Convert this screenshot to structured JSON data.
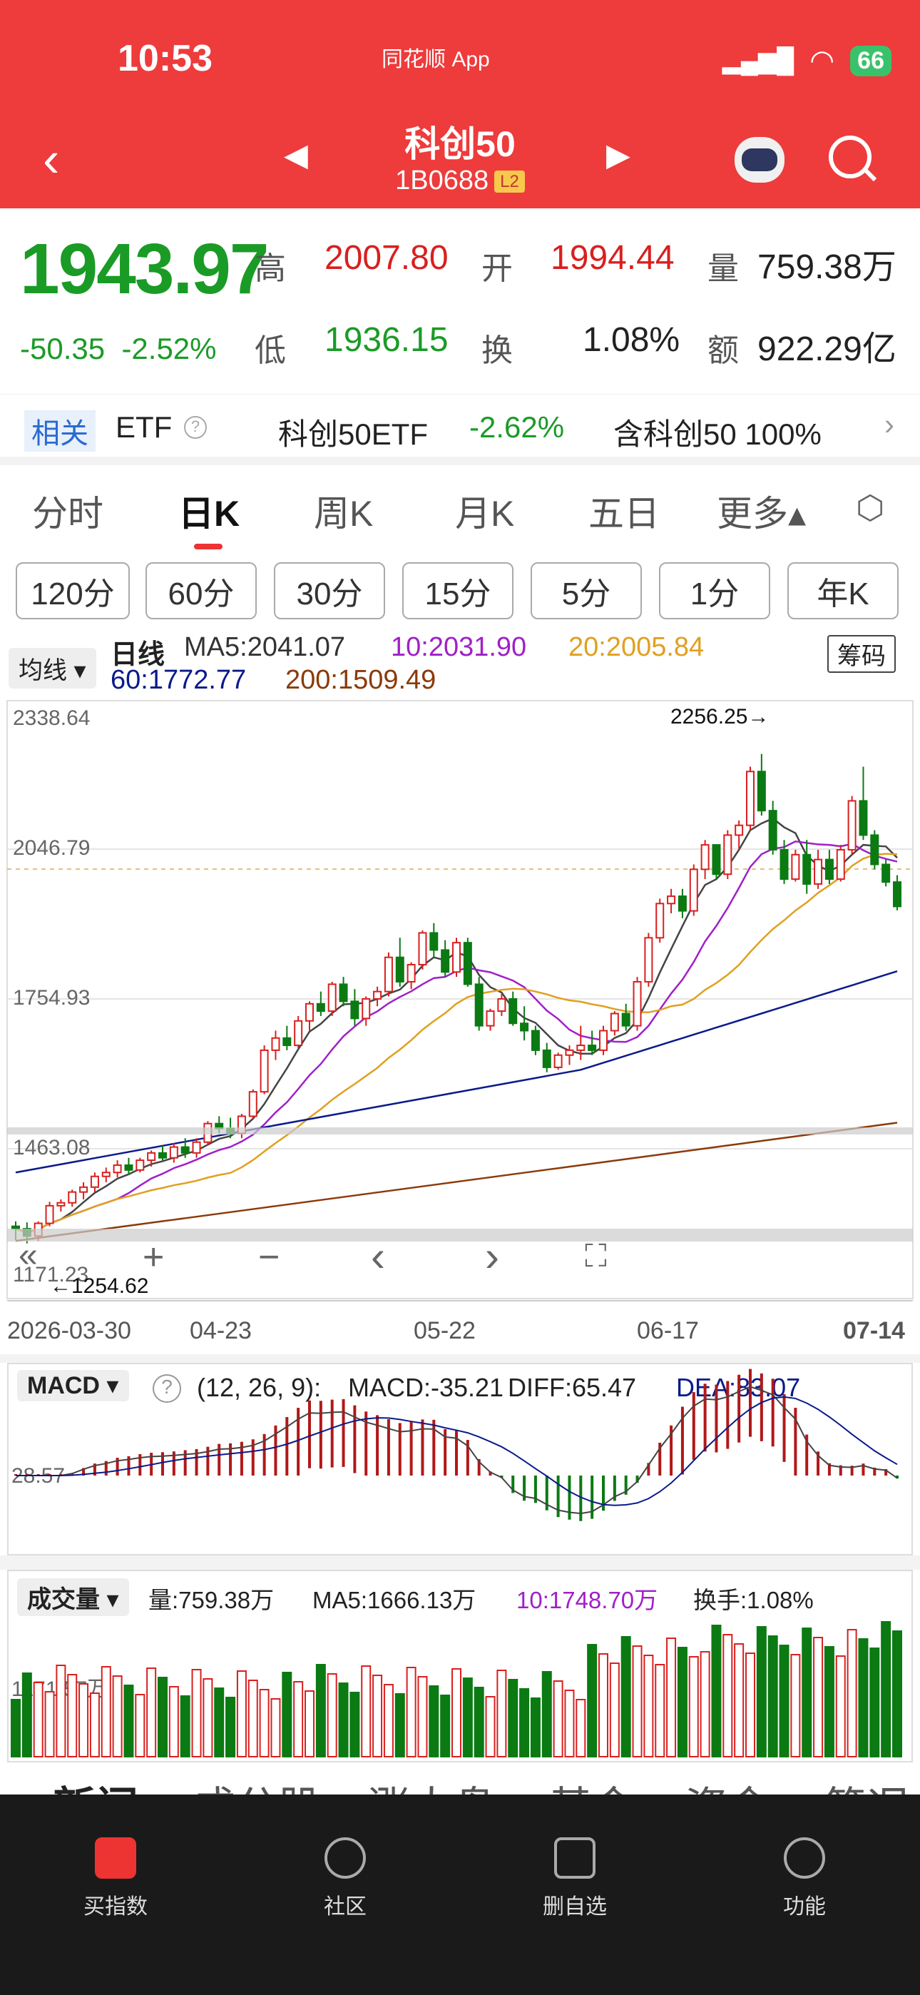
{
  "status": {
    "time": "10:53",
    "app": "同花顺 App",
    "battery": "66"
  },
  "header": {
    "title": "科创50",
    "code": "1B0688",
    "level": "L2"
  },
  "quote": {
    "price": "1943.97",
    "change": "-50.35",
    "pct": "-2.52%",
    "high_label": "高",
    "high": "2007.80",
    "open_label": "开",
    "open": "1994.44",
    "vol_label": "量",
    "vol": "759.38万",
    "low_label": "低",
    "low": "1936.15",
    "turn_label": "换",
    "turn": "1.08%",
    "amt_label": "额",
    "amt": "922.29亿"
  },
  "etf": {
    "tag": "相关",
    "etf_label": "ETF",
    "name": "科创50ETF",
    "pct": "-2.62%",
    "holding": "含科创50 100%"
  },
  "tabs": [
    "分时",
    "日K",
    "周K",
    "月K",
    "五日",
    "更多▴"
  ],
  "periods": [
    "120分",
    "60分",
    "30分",
    "15分",
    "5分",
    "1分",
    "年K"
  ],
  "ma": {
    "selector": "均线",
    "type": "日线",
    "ma5": "MA5:2041.07",
    "ma10": "10:2031.90",
    "ma20": "20:2005.84",
    "ma60": "60:1772.77",
    "ma200": "200:1509.49",
    "chips": "筹码"
  },
  "kline": {
    "y_labels": [
      "2338.64",
      "2046.79",
      "1754.93",
      "1463.08",
      "1171.23"
    ],
    "high_mark": "2256.25→",
    "low_mark": "←1254.62",
    "x_labels": [
      "2026-03-30",
      "04-23",
      "05-22",
      "06-17",
      "07-14"
    ],
    "controls": [
      "«",
      "+",
      "−",
      "‹",
      "›",
      "⛶"
    ]
  },
  "macd": {
    "name": "MACD",
    "params": "(12, 26, 9):",
    "macd": "MACD:-35.21",
    "diff": "DIFF:65.47",
    "dea": "DEA:83.07",
    "axis": "28.57"
  },
  "volume": {
    "name": "成交量",
    "vol": "量:759.38万",
    "ma5": "MA5:1666.13万",
    "ma10": "10:1748.70万",
    "turn": "换手:1.08%",
    "axis": "1171.57万"
  },
  "subtabs": [
    "新闻",
    "成分股",
    "涨大盘",
    "基金",
    "资金",
    "简况"
  ],
  "bottom_nav": [
    "买指数",
    "社区",
    "删自选",
    "功能"
  ],
  "chart_data": {
    "type": "candlestick",
    "candles": [
      [
        1290,
        1300,
        1262,
        1285
      ],
      [
        1285,
        1298,
        1255,
        1270
      ],
      [
        1270,
        1300,
        1260,
        1296
      ],
      [
        1296,
        1340,
        1290,
        1332
      ],
      [
        1332,
        1345,
        1320,
        1338
      ],
      [
        1338,
        1365,
        1330,
        1360
      ],
      [
        1360,
        1380,
        1345,
        1370
      ],
      [
        1370,
        1400,
        1360,
        1392
      ],
      [
        1392,
        1410,
        1380,
        1400
      ],
      [
        1400,
        1425,
        1390,
        1415
      ],
      [
        1415,
        1430,
        1395,
        1405
      ],
      [
        1405,
        1430,
        1400,
        1425
      ],
      [
        1425,
        1445,
        1412,
        1440
      ],
      [
        1440,
        1455,
        1425,
        1430
      ],
      [
        1430,
        1460,
        1420,
        1452
      ],
      [
        1452,
        1470,
        1430,
        1440
      ],
      [
        1440,
        1470,
        1430,
        1462
      ],
      [
        1462,
        1505,
        1455,
        1500
      ],
      [
        1500,
        1515,
        1480,
        1490
      ],
      [
        1490,
        1512,
        1470,
        1480
      ],
      [
        1480,
        1520,
        1470,
        1515
      ],
      [
        1515,
        1570,
        1510,
        1565
      ],
      [
        1565,
        1660,
        1560,
        1650
      ],
      [
        1650,
        1690,
        1630,
        1675
      ],
      [
        1675,
        1700,
        1650,
        1660
      ],
      [
        1660,
        1720,
        1655,
        1710
      ],
      [
        1710,
        1750,
        1690,
        1745
      ],
      [
        1745,
        1770,
        1720,
        1730
      ],
      [
        1730,
        1790,
        1720,
        1785
      ],
      [
        1785,
        1800,
        1740,
        1750
      ],
      [
        1750,
        1775,
        1700,
        1715
      ],
      [
        1715,
        1760,
        1700,
        1755
      ],
      [
        1755,
        1780,
        1740,
        1770
      ],
      [
        1770,
        1850,
        1760,
        1840
      ],
      [
        1840,
        1880,
        1780,
        1790
      ],
      [
        1790,
        1830,
        1775,
        1825
      ],
      [
        1825,
        1895,
        1815,
        1890
      ],
      [
        1890,
        1910,
        1840,
        1855
      ],
      [
        1855,
        1875,
        1800,
        1810
      ],
      [
        1810,
        1880,
        1800,
        1870
      ],
      [
        1870,
        1880,
        1780,
        1785
      ],
      [
        1785,
        1800,
        1690,
        1700
      ],
      [
        1700,
        1735,
        1690,
        1730
      ],
      [
        1730,
        1765,
        1720,
        1755
      ],
      [
        1755,
        1770,
        1700,
        1705
      ],
      [
        1705,
        1740,
        1670,
        1690
      ],
      [
        1690,
        1700,
        1640,
        1650
      ],
      [
        1650,
        1665,
        1605,
        1615
      ],
      [
        1615,
        1645,
        1610,
        1640
      ],
      [
        1640,
        1660,
        1620,
        1650
      ],
      [
        1650,
        1700,
        1630,
        1660
      ],
      [
        1660,
        1690,
        1640,
        1650
      ],
      [
        1650,
        1700,
        1640,
        1690
      ],
      [
        1690,
        1730,
        1680,
        1725
      ],
      [
        1725,
        1745,
        1690,
        1700
      ],
      [
        1700,
        1800,
        1690,
        1790
      ],
      [
        1790,
        1890,
        1780,
        1880
      ],
      [
        1880,
        1960,
        1870,
        1950
      ],
      [
        1950,
        1980,
        1930,
        1965
      ],
      [
        1965,
        1980,
        1920,
        1935
      ],
      [
        1935,
        2030,
        1925,
        2020
      ],
      [
        2020,
        2080,
        2000,
        2070
      ],
      [
        2070,
        2060,
        2000,
        2010
      ],
      [
        2010,
        2100,
        2000,
        2090
      ],
      [
        2090,
        2120,
        2060,
        2110
      ],
      [
        2110,
        2230,
        2100,
        2220
      ],
      [
        2220,
        2256,
        2130,
        2140
      ],
      [
        2140,
        2160,
        2050,
        2060
      ],
      [
        2060,
        2080,
        1990,
        2000
      ],
      [
        2000,
        2060,
        1995,
        2050
      ],
      [
        2050,
        2080,
        1970,
        1990
      ],
      [
        1990,
        2060,
        1980,
        2040
      ],
      [
        2040,
        2060,
        1990,
        2000
      ],
      [
        2000,
        2070,
        1995,
        2060
      ],
      [
        2060,
        2170,
        2050,
        2160
      ],
      [
        2160,
        2230,
        2080,
        2090
      ],
      [
        2090,
        2100,
        2020,
        2030
      ],
      [
        2030,
        2040,
        1985,
        1994
      ],
      [
        1994,
        2008,
        1936,
        1944
      ]
    ],
    "ylim": [
      1171.23,
      2338.64
    ]
  }
}
